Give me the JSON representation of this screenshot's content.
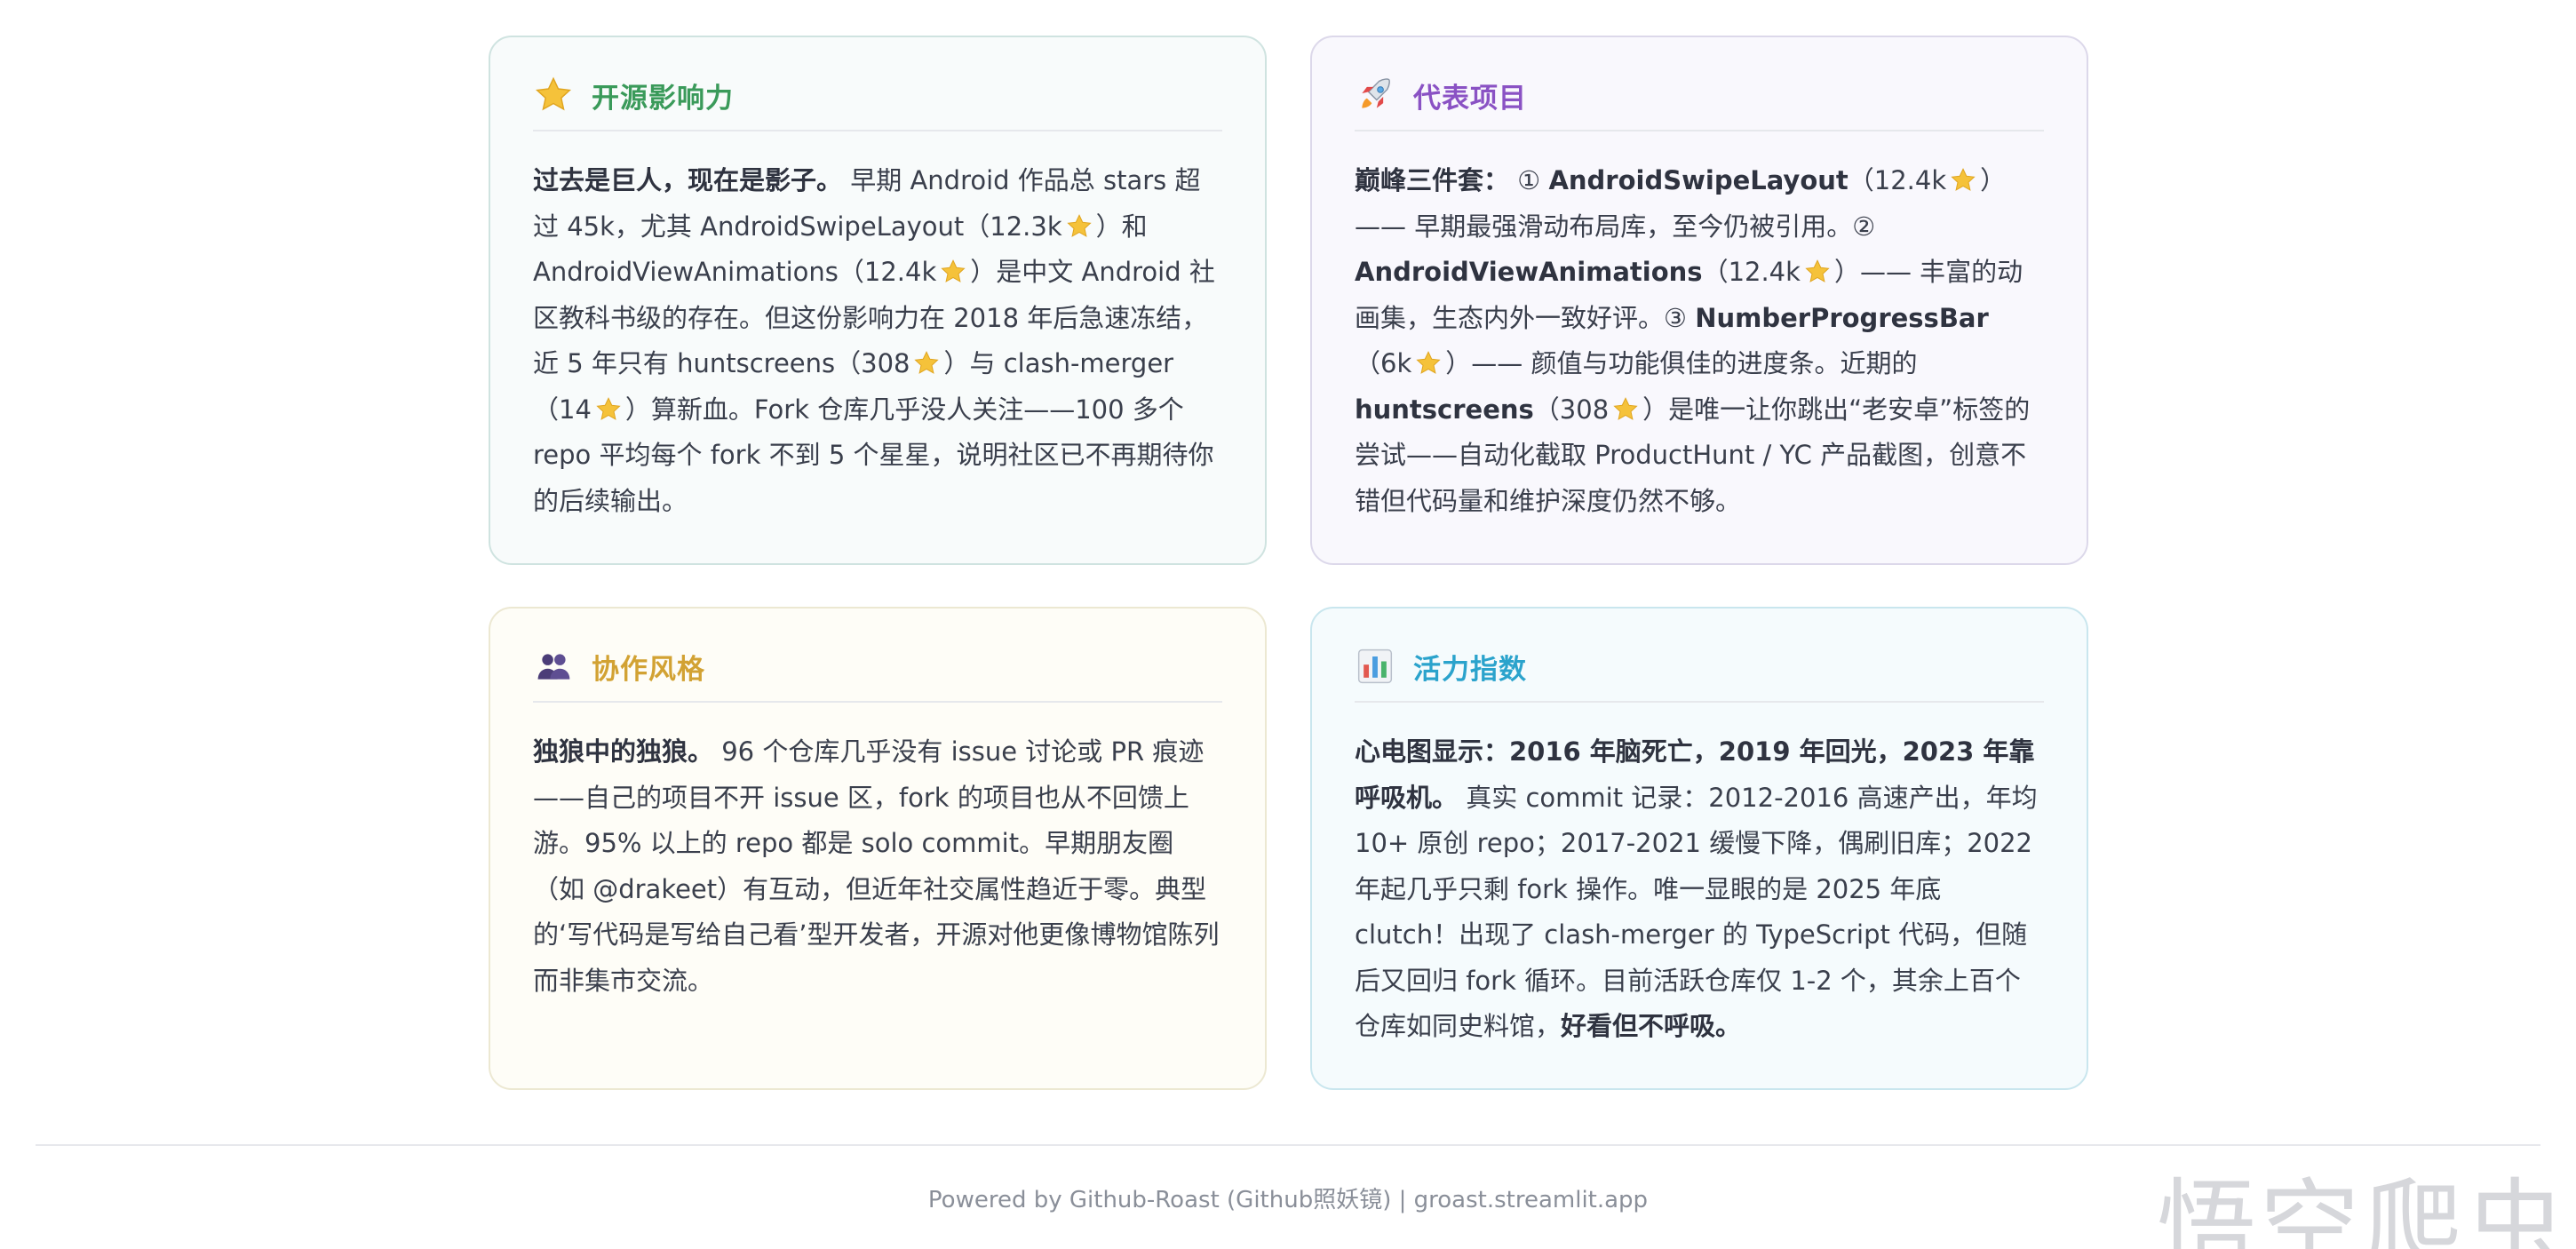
{
  "cards": {
    "influence": {
      "title": "开源影响力",
      "icon": "star-icon",
      "lead": "过去是巨人，现在是影子。",
      "p1": " 早期 Android 作品总 stars 超过 45k，尤其 AndroidSwipeLayout（12.3k",
      "p2": "）和 AndroidViewAnimations（12.4k",
      "p3": "）是中文 Android 社区教科书级的存在。但这份影响力在 2018 年后急速冻结，近 5 年只有 huntscreens（308",
      "p4": "）与 clash-merger（14",
      "p5": "）算新血。Fork 仓库几乎没人关注——100 多个 repo 平均每个 fork 不到 5 个星星，说明社区已不再期待你的后续输出。"
    },
    "projects": {
      "title": "代表项目",
      "icon": "rocket-icon",
      "lead": "巅峰三件套：",
      "p1": " ① ",
      "b1": "AndroidSwipeLayout",
      "p2": "（12.4k",
      "p3": "）—— 早期最强滑动布局库，至今仍被引用。② ",
      "b2": "AndroidViewAnimations",
      "p4": "（12.4k",
      "p5": "）—— 丰富的动画集，生态内外一致好评。③ ",
      "b3": "NumberProgressBar",
      "p6": "（6k",
      "p7": "）—— 颜值与功能俱佳的进度条。近期的 ",
      "b4": "huntscreens",
      "p8": "（308",
      "p9": "）是唯一让你跳出“老安卓”标签的尝试——自动化截取 ProductHunt / YC 产品截图，创意不错但代码量和维护深度仍然不够。"
    },
    "collab": {
      "title": "协作风格",
      "icon": "people-icon",
      "lead": "独狼中的独狼。",
      "p1": " 96 个仓库几乎没有 issue 讨论或 PR 痕迹——自己的项目不开 issue 区，fork 的项目也从不回馈上游。95% 以上的 repo 都是 solo commit。早期朋友圈（如 @drakeet）有互动，但近年社交属性趋近于零。典型的‘写代码是写给自己看’型开发者，开源对他更像博物馆陈列而非集市交流。"
    },
    "vitality": {
      "title": "活力指数",
      "icon": "bar-chart-icon",
      "lead": "心电图显示：2016 年脑死亡，2019 年回光，2023 年靠呼吸机。",
      "p1": " 真实 commit 记录：2012-2016 高速产出，年均 10+ 原创 repo；2017-2021 缓慢下降，偶刷旧库；2022 年起几乎只剩 fork 操作。唯一显眼的是 2025 年底 clutch！出现了 clash-merger 的 TypeScript 代码，但随后又回归 fork 循环。目前活跃仓库仅 1-2 个，其余上百个仓库如同史料馆，",
      "b1": "好看但不呼吸。"
    }
  },
  "footer": {
    "text": "Powered by Github-Roast (Github照妖镜) | groast.streamlit.app"
  },
  "watermark": "悟空爬虫",
  "colors": {
    "influence_title": "#3a9a5a",
    "projects_title": "#8a52c4",
    "collab_title": "#d2a233",
    "vitality_title": "#2ba3cc",
    "star": "#f5c23a"
  }
}
